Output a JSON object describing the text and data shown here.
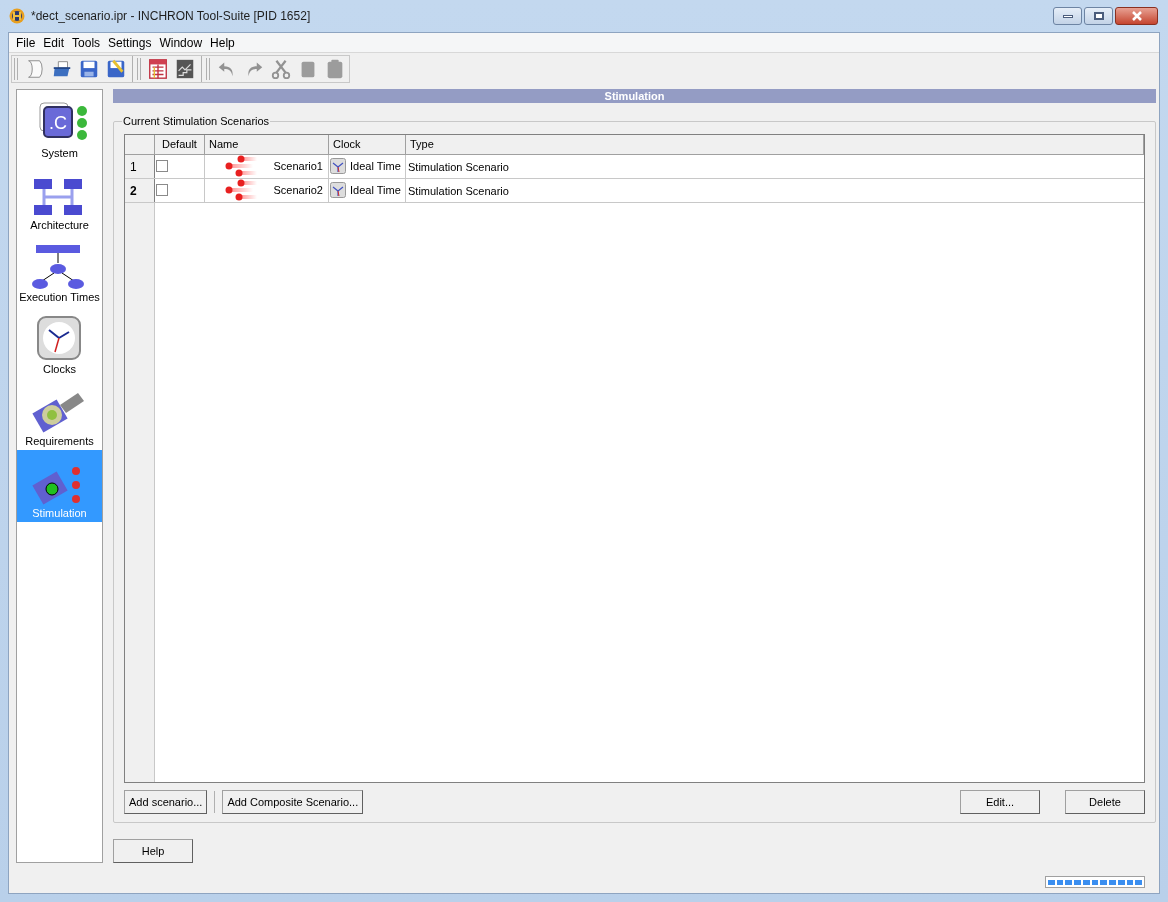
{
  "window": {
    "title": "*dect_scenario.ipr - INCHRON Tool-Suite [PID 1652]"
  },
  "menu": [
    "File",
    "Edit",
    "Tools",
    "Settings",
    "Window",
    "Help"
  ],
  "toolbar": [
    {
      "kind": "new",
      "disabled": false
    },
    {
      "kind": "open",
      "disabled": false
    },
    {
      "kind": "save",
      "disabled": false
    },
    {
      "kind": "save-as",
      "disabled": false
    },
    {
      "kind": "sep"
    },
    {
      "kind": "table",
      "disabled": false
    },
    {
      "kind": "chart",
      "disabled": false
    },
    {
      "kind": "sep"
    },
    {
      "kind": "undo",
      "disabled": true
    },
    {
      "kind": "redo",
      "disabled": true
    },
    {
      "kind": "cut",
      "disabled": true
    },
    {
      "kind": "copy",
      "disabled": true
    },
    {
      "kind": "paste",
      "disabled": true
    }
  ],
  "sidebar": {
    "items": [
      {
        "label": "System",
        "kind": "system",
        "icon_text": ".C",
        "selected": false
      },
      {
        "label": "Architecture",
        "kind": "architecture",
        "selected": false
      },
      {
        "label": "Execution Times",
        "kind": "execution",
        "selected": false
      },
      {
        "label": "Clocks",
        "kind": "clock",
        "selected": false
      },
      {
        "label": "Requirements",
        "kind": "requirements",
        "selected": false
      },
      {
        "label": "Stimulation",
        "kind": "stimulation",
        "selected": true
      }
    ]
  },
  "page_title": "Stimulation",
  "group": {
    "title": "Current Stimulation Scenarios",
    "table": {
      "columns": [
        "Default",
        "Name",
        "Clock",
        "Type"
      ],
      "rows": [
        {
          "number": "1",
          "selected": false,
          "default": false,
          "name": "Scenario1",
          "clock": "Ideal Time",
          "type": "Stimulation Scenario"
        },
        {
          "number": "2",
          "selected": true,
          "default": false,
          "name": "Scenario2",
          "clock": "Ideal Time",
          "type": "Stimulation Scenario"
        }
      ]
    },
    "buttons_left": [
      "Add scenario...",
      "Add Composite Scenario..."
    ],
    "buttons_right": [
      "Edit...",
      "Delete"
    ]
  },
  "help_button": "Help"
}
